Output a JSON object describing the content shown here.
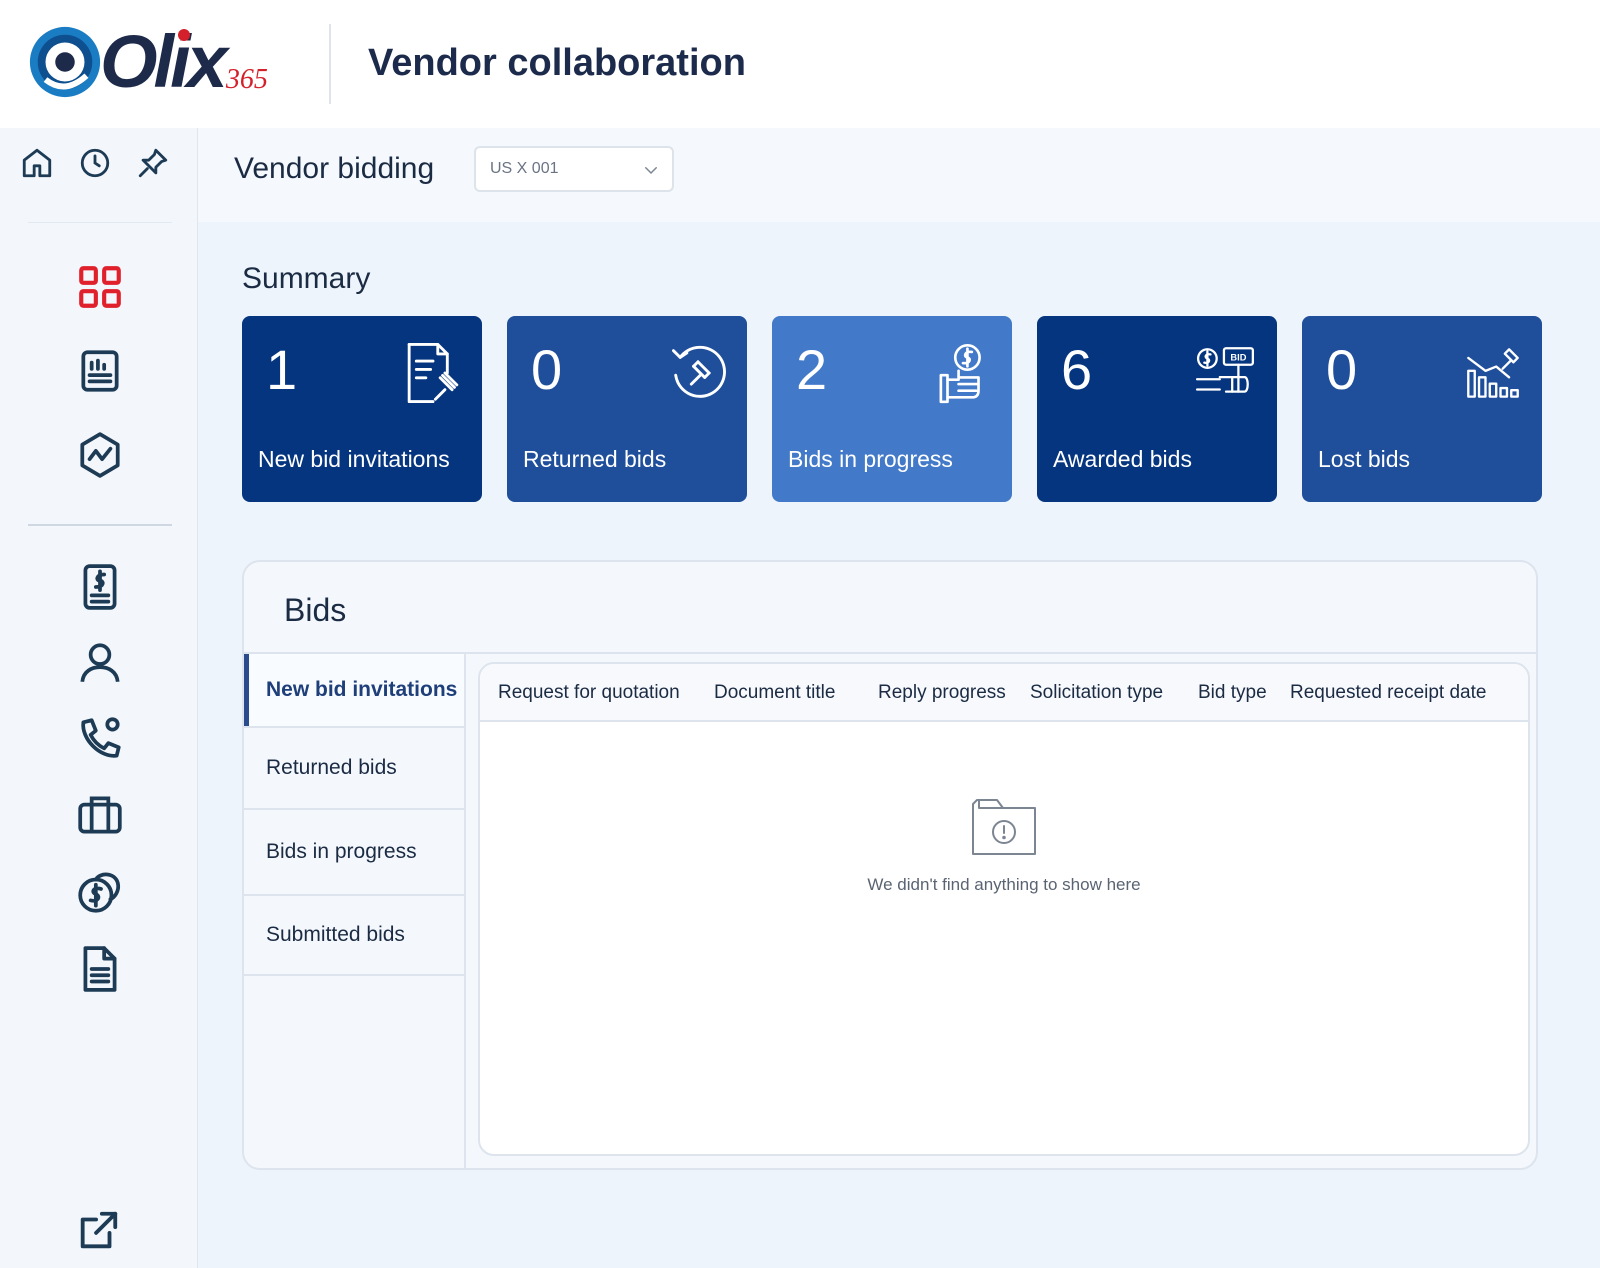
{
  "app": {
    "logo_text": "Olix",
    "logo_sub": "365",
    "title": "Vendor collaboration"
  },
  "page": {
    "title": "Vendor bidding",
    "company_select": "US X 001"
  },
  "summary": {
    "title": "Summary",
    "cards": [
      {
        "value": "1",
        "label": "New bid invitations",
        "color": "#05357f",
        "icon": "document-gavel-icon"
      },
      {
        "value": "0",
        "label": "Returned bids",
        "color": "#1f4e9b",
        "icon": "return-gavel-icon"
      },
      {
        "value": "2",
        "label": "Bids in progress",
        "color": "#4279c8",
        "icon": "hand-dollar-icon"
      },
      {
        "value": "6",
        "label": "Awarded bids",
        "color": "#05357f",
        "icon": "bid-sign-icon"
      },
      {
        "value": "0",
        "label": "Lost bids",
        "color": "#1f4e9b",
        "icon": "chart-down-gavel-icon"
      }
    ]
  },
  "bids": {
    "title": "Bids",
    "tabs": [
      "New bid invitations",
      "Returned bids",
      "Bids in progress",
      "Submitted bids"
    ],
    "active_tab": 0,
    "columns": [
      "Request for quotation",
      "Document title",
      "Reply progress",
      "Solicitation type",
      "Bid type",
      "Requested receipt date"
    ],
    "empty_message": "We didn't find anything to show here"
  },
  "colors": {
    "accent": "#d4202a",
    "navy": "#05357f",
    "text": "#1b2b44"
  }
}
